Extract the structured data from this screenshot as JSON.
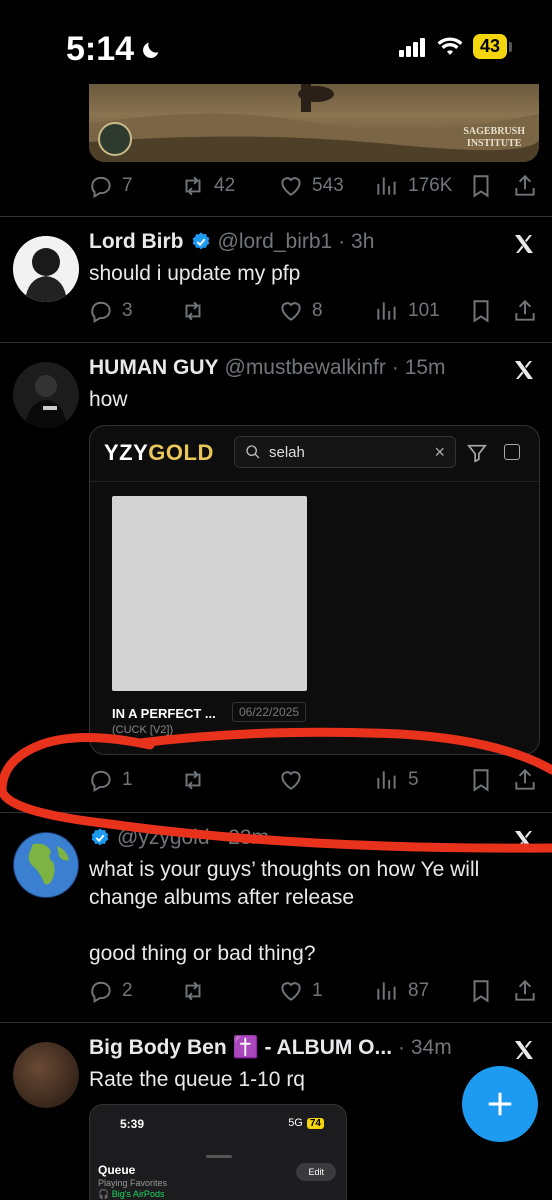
{
  "status_bar": {
    "time": "5:14",
    "battery": "43"
  },
  "post1": {
    "media_label_line1": "SAGEBRUSH",
    "media_label_line2": "INSTITUTE",
    "replies": "7",
    "reposts": "42",
    "likes": "543",
    "views": "176K"
  },
  "post2": {
    "name": "Lord Birb",
    "handle": "@lord_birb1",
    "time": "· 3h",
    "text": "should i update my pfp",
    "replies": "3",
    "reposts": "",
    "likes": "8",
    "views": "101"
  },
  "post3": {
    "name": "HUMAN GUY",
    "handle": "@mustbewalkinfr",
    "time": "· 15m",
    "text": "how",
    "card": {
      "logo_white": "YZY",
      "logo_gold": "GOLD",
      "search_value": "selah",
      "item_title": "IN A PERFECT ...",
      "item_date": "06/22/2025",
      "item_sub": "(CUCK [V2])"
    },
    "replies": "1",
    "reposts": "",
    "likes": "",
    "views": "5"
  },
  "post4": {
    "handle": "@yzygold · 23m",
    "text_line1": "what is your guys’ thoughts on how Ye will",
    "text_line2": "change albums after release",
    "text_line3": "good thing or bad thing?",
    "replies": "2",
    "reposts": "",
    "likes": "1",
    "views": "87"
  },
  "post5": {
    "name": "Big Body Ben ✝️ - ALBUM O...",
    "time": "· 34m",
    "text": "Rate the queue 1-10 rq",
    "queue": {
      "time": "5:39",
      "network": "5G",
      "battery": "74",
      "title": "Queue",
      "sub": "Playing Favorites",
      "device": "🎧 Big's AirPods",
      "edit": "Edit"
    }
  },
  "colors": {
    "accent": "#1d9bf0",
    "annotation": "#e8321c",
    "gold": "#e8c65a"
  }
}
